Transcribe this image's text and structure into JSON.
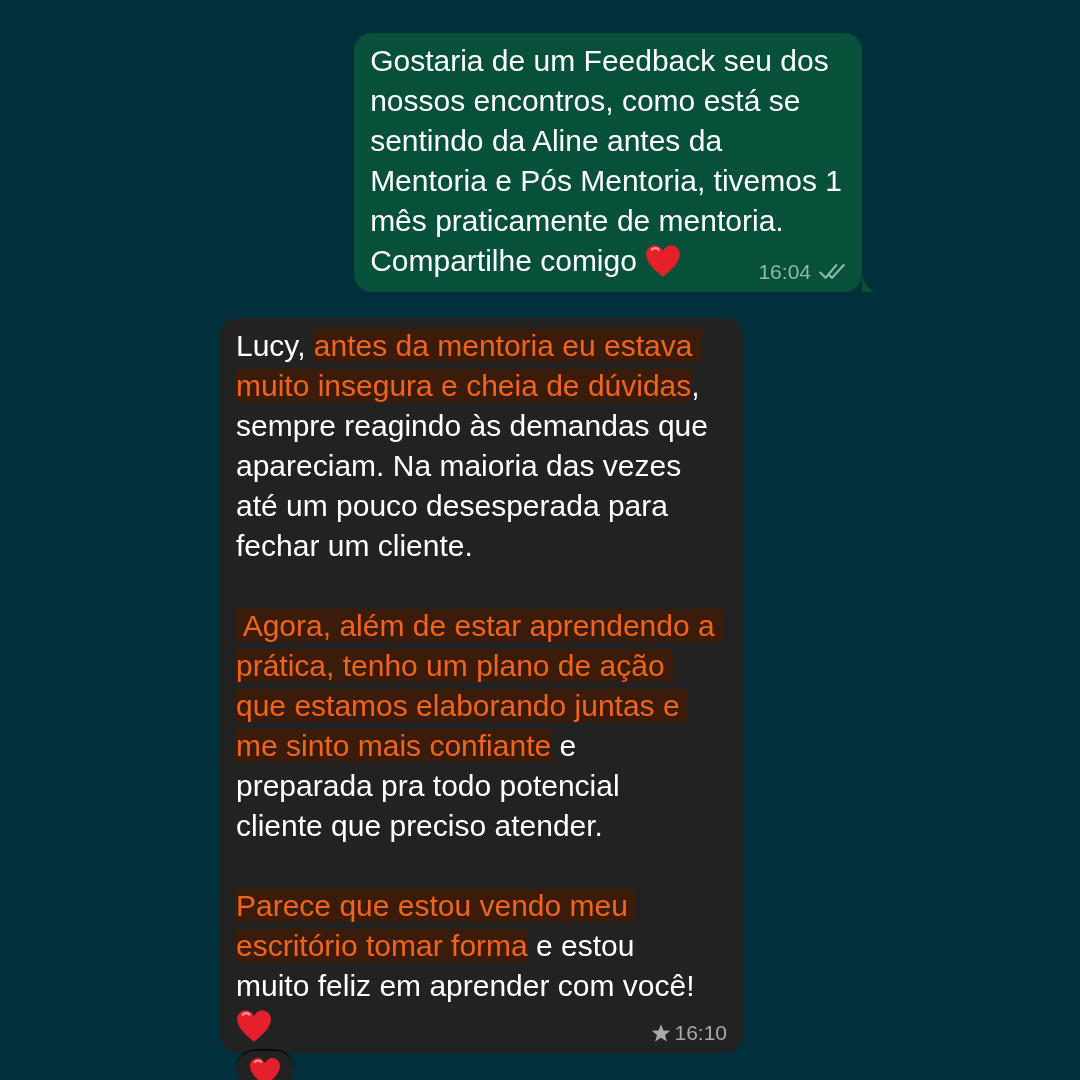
{
  "messages": [
    {
      "kind": "outgoing",
      "paragraphs": [
        [
          [
            {
              "kind": "plain",
              "text": "Gostaria de um Feedback seu dos"
            }
          ],
          [
            {
              "kind": "plain",
              "text": "nossos encontros, como está se"
            }
          ],
          [
            {
              "kind": "plain",
              "text": "sentindo da Aline antes da"
            }
          ],
          [
            {
              "kind": "plain",
              "text": "Mentoria e Pós Mentoria, tivemos 1"
            }
          ],
          [
            {
              "kind": "plain",
              "text": "mês praticamente de mentoria."
            }
          ],
          [
            {
              "kind": "plain",
              "text": "Compartilhe comigo "
            },
            {
              "kind": "heart"
            }
          ]
        ]
      ],
      "time": "16:04",
      "read": true
    },
    {
      "kind": "incoming",
      "paragraphs": [
        [
          [
            {
              "kind": "plain",
              "text": "Lucy, "
            },
            {
              "kind": "highlight",
              "text": "antes da mentoria eu estava "
            }
          ],
          [
            {
              "kind": "highlight",
              "text": "muito insegura e cheia de dúvidas"
            },
            {
              "kind": "plain",
              "text": ","
            }
          ],
          [
            {
              "kind": "plain",
              "text": "sempre reagindo às demandas que"
            }
          ],
          [
            {
              "kind": "plain",
              "text": "apareciam. Na maioria das vezes"
            }
          ],
          [
            {
              "kind": "plain",
              "text": "até um pouco desesperada para"
            }
          ],
          [
            {
              "kind": "plain",
              "text": "fechar um cliente."
            }
          ]
        ],
        [
          [
            {
              "kind": "highlight",
              "text": " Agora, além de estar aprendendo a "
            }
          ],
          [
            {
              "kind": "highlight",
              "text": "prática, tenho um plano de ação "
            }
          ],
          [
            {
              "kind": "highlight",
              "text": "que estamos elaborando juntas e "
            }
          ],
          [
            {
              "kind": "highlight",
              "text": "me sinto mais confiante"
            },
            {
              "kind": "plain",
              "text": " e"
            }
          ],
          [
            {
              "kind": "plain",
              "text": "preparada pra todo potencial"
            }
          ],
          [
            {
              "kind": "plain",
              "text": "cliente que preciso atender."
            }
          ]
        ],
        [
          [
            {
              "kind": "highlight",
              "text": "Parece que estou vendo meu "
            }
          ],
          [
            {
              "kind": "highlight",
              "text": "escritório tomar forma"
            },
            {
              "kind": "plain",
              "text": " e estou"
            }
          ],
          [
            {
              "kind": "plain",
              "text": "muito feliz em aprender com você!"
            }
          ],
          [
            {
              "kind": "heart"
            }
          ]
        ]
      ],
      "time": "16:10",
      "starred": true,
      "reaction": true
    }
  ]
}
